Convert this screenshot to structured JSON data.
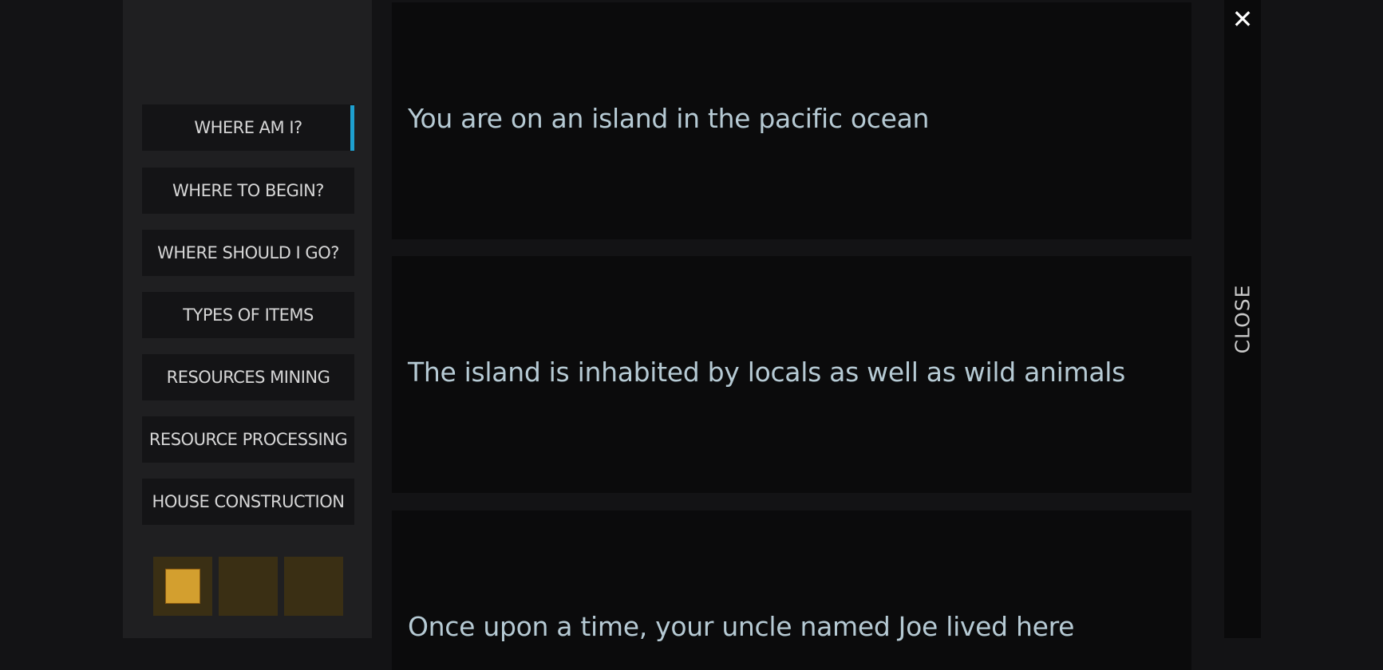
{
  "sidebar": {
    "items": [
      {
        "label": "WHERE AM I?",
        "active": true
      },
      {
        "label": "WHERE TO BEGIN?",
        "active": false
      },
      {
        "label": "WHERE SHOULD I GO?",
        "active": false
      },
      {
        "label": "TYPES OF ITEMS",
        "active": false
      },
      {
        "label": "RESOURCES MINING",
        "active": false
      },
      {
        "label": "RESOURCE PROCESSING",
        "active": false
      },
      {
        "label": "HOUSE CONSTRUCTION",
        "active": false
      }
    ],
    "pager": {
      "total": 3,
      "current": 1
    },
    "accent_color": "#1ea0d0",
    "pager_color": "#d39f2f"
  },
  "content": {
    "cards": [
      {
        "text": "You are on an island in the pacific ocean"
      },
      {
        "text": "The island is inhabited by locals as well as wild animals"
      },
      {
        "text": "Once upon a time, your uncle named Joe lived here"
      }
    ]
  },
  "close": {
    "icon": "close-x-icon",
    "icon_glyph": "✕",
    "label": "CLOSE"
  }
}
